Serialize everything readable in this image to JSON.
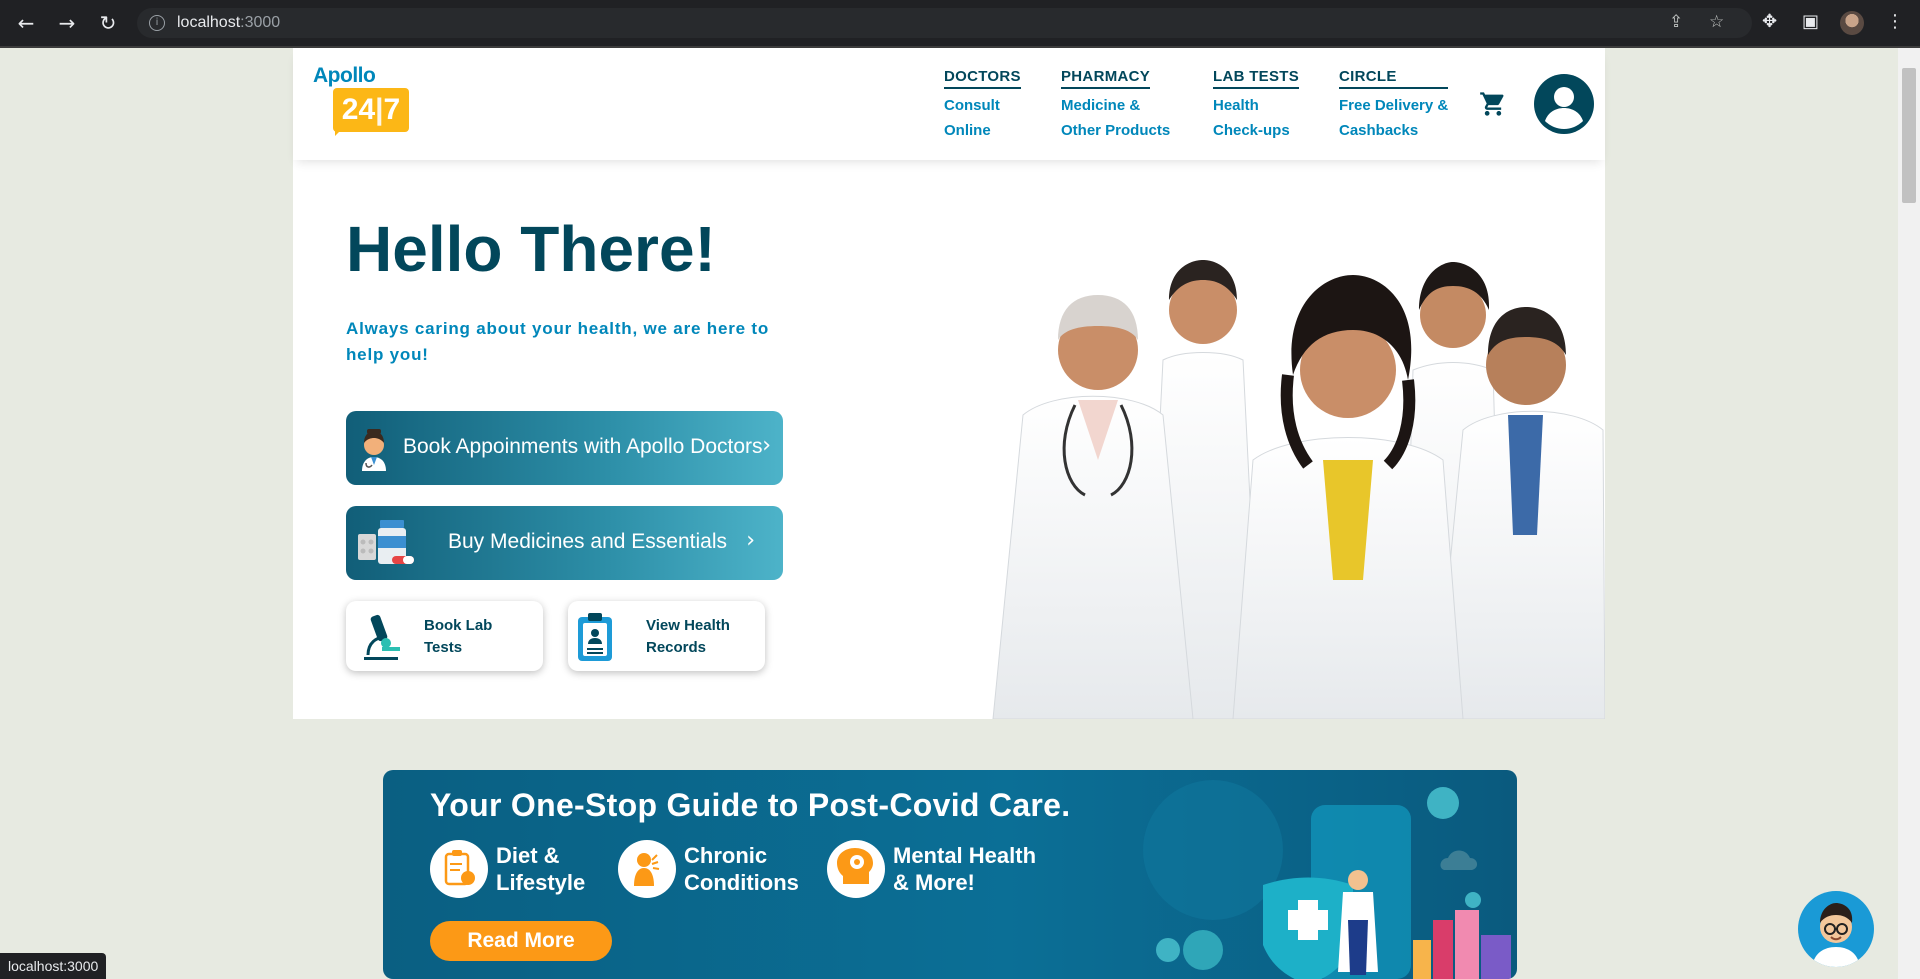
{
  "browser": {
    "url_host": "localhost",
    "url_port": ":3000",
    "status_text": "localhost:3000"
  },
  "header": {
    "logo_word": "Apollo",
    "logo_badge": "24|7",
    "menu": [
      {
        "title": "DOCTORS",
        "sub1": "Consult",
        "sub2": "Online"
      },
      {
        "title": "PHARMACY",
        "sub1": "Medicine &",
        "sub2": "Other Products"
      },
      {
        "title": "LAB TESTS",
        "sub1": "Health",
        "sub2": "Check-ups"
      },
      {
        "title": "CIRCLE",
        "sub1": "Free Delivery &",
        "sub2": "Cashbacks"
      }
    ]
  },
  "hero": {
    "greeting": "Hello There!",
    "tagline": "Always caring about your health, we are here to help you!",
    "cta_doctors": "Book Appoinments with Apollo Doctors",
    "cta_medicines": "Buy Medicines and Essentials",
    "card_lab": "Book Lab Tests",
    "card_records": "View Health Records"
  },
  "banner": {
    "headline": "Your One-Stop Guide to Post-Covid Care.",
    "features": [
      {
        "line1": "Diet &",
        "line2": "Lifestyle"
      },
      {
        "line1": "Chronic",
        "line2": "Conditions"
      },
      {
        "line1": "Mental Health",
        "line2": "& More!"
      }
    ],
    "read_more": "Read More"
  },
  "colors": {
    "brand_dark": "#02475b",
    "brand_blue": "#0087ba",
    "brand_yellow": "#fcb716",
    "accent_orange": "#fc9916",
    "page_bg": "#e7eae1"
  }
}
